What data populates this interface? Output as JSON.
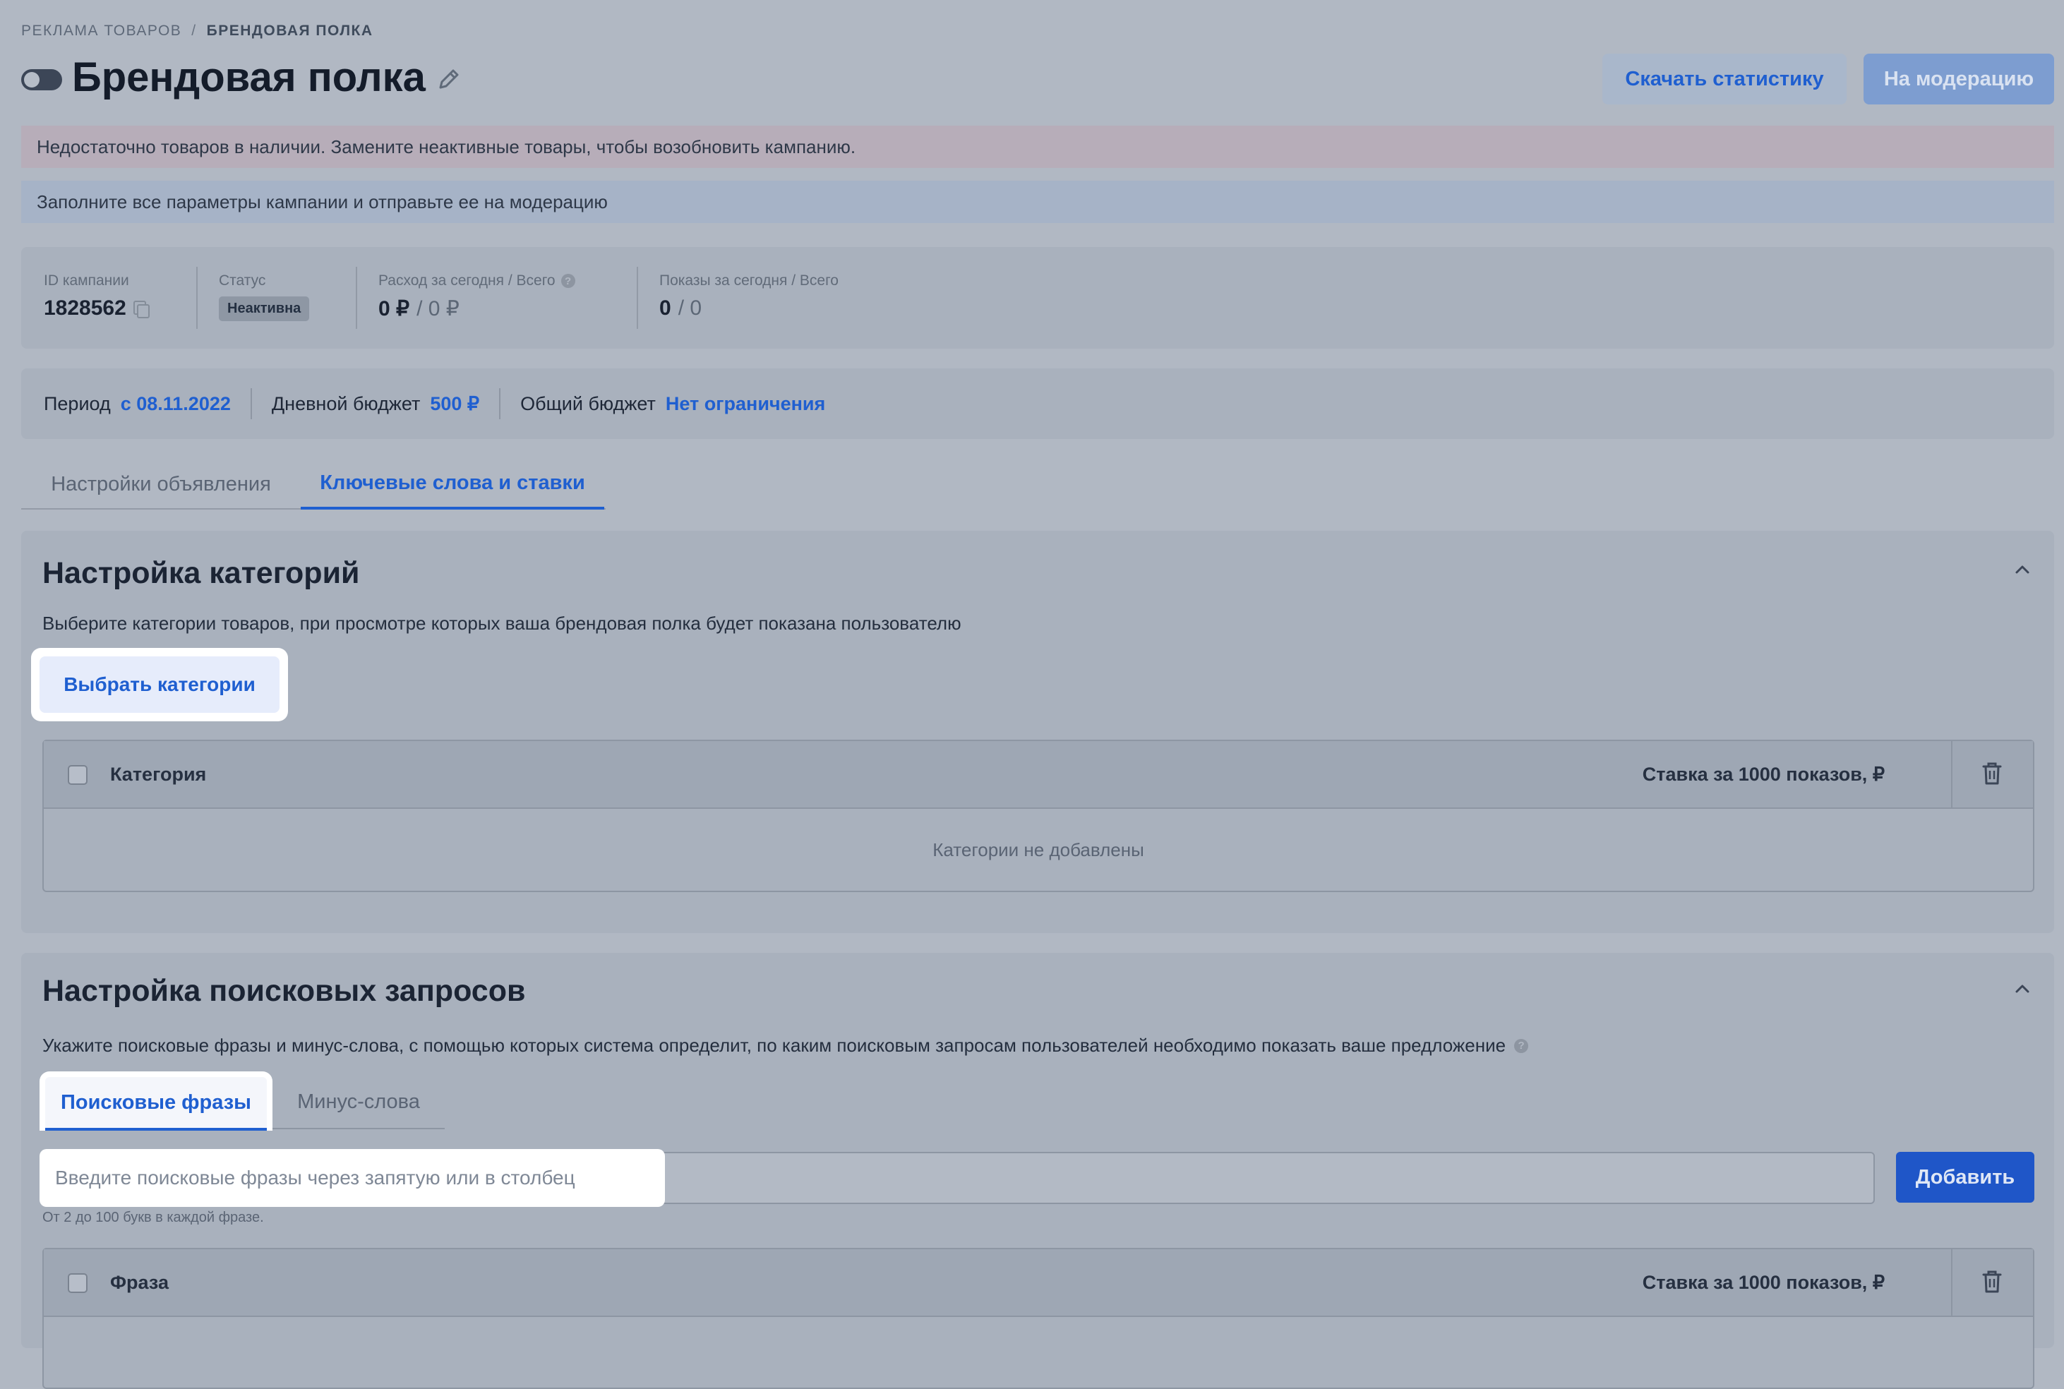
{
  "breadcrumbs": {
    "first": "РЕКЛАМА ТОВАРОВ",
    "separator": "/",
    "current": "БРЕНДОВАЯ ПОЛКА"
  },
  "header": {
    "title": "Брендовая полка",
    "download_stats_label": "Скачать статистику",
    "moderation_label": "На модерацию"
  },
  "alerts": {
    "warning": "Недостаточно товаров в наличии. Замените неактивные товары, чтобы возобновить кампанию.",
    "info": "Заполните все параметры кампании и отправьте ее на модерацию"
  },
  "stats": {
    "campaign_id_label": "ID кампании",
    "campaign_id": "1828562",
    "status_label": "Статус",
    "status": "Неактивна",
    "spend_label": "Расход за сегодня / Всего",
    "spend_today": "0 ₽",
    "spend_total": "/ 0 ₽",
    "shows_label": "Показы за сегодня / Всего",
    "shows_today": "0",
    "shows_total": "/ 0"
  },
  "period": {
    "period_label": "Период",
    "period_value": "с 08.11.2022",
    "daily_budget_label": "Дневной бюджет",
    "daily_budget_value": "500 ₽",
    "total_budget_label": "Общий бюджет",
    "total_budget_value": "Нет ограничения"
  },
  "tabs": [
    {
      "label": "Настройки объявления",
      "active": false
    },
    {
      "label": "Ключевые слова и ставки",
      "active": true
    }
  ],
  "categories_section": {
    "title": "Настройка категорий",
    "description": "Выберите категории товаров, при просмотре которых ваша брендовая полка будет показана пользователю",
    "select_button": "Выбрать категории",
    "table": {
      "col_category": "Категория",
      "col_rate": "Ставка за 1000 показов, ₽",
      "empty_text": "Категории не добавлены"
    }
  },
  "search_section": {
    "title": "Настройка поисковых запросов",
    "description": "Укажите поисковые фразы и минус-слова, с помощью которых система определит, по каким поисковым запросам пользователей необходимо показать ваше предложение",
    "subtabs": [
      {
        "label": "Поисковые фразы",
        "active": true
      },
      {
        "label": "Минус-слова",
        "active": false
      }
    ],
    "input_placeholder": "Введите поисковые фразы через запятую или в столбец",
    "input_value": "",
    "add_button": "Добавить",
    "hint": "От 2 до 100 букв в каждой фразе.",
    "table": {
      "col_phrase": "Фраза",
      "col_rate": "Ставка за 1000 показов, ₽"
    }
  },
  "colors": {
    "accent": "#1f5fd0",
    "overlay_background": "#b1b8c3"
  }
}
